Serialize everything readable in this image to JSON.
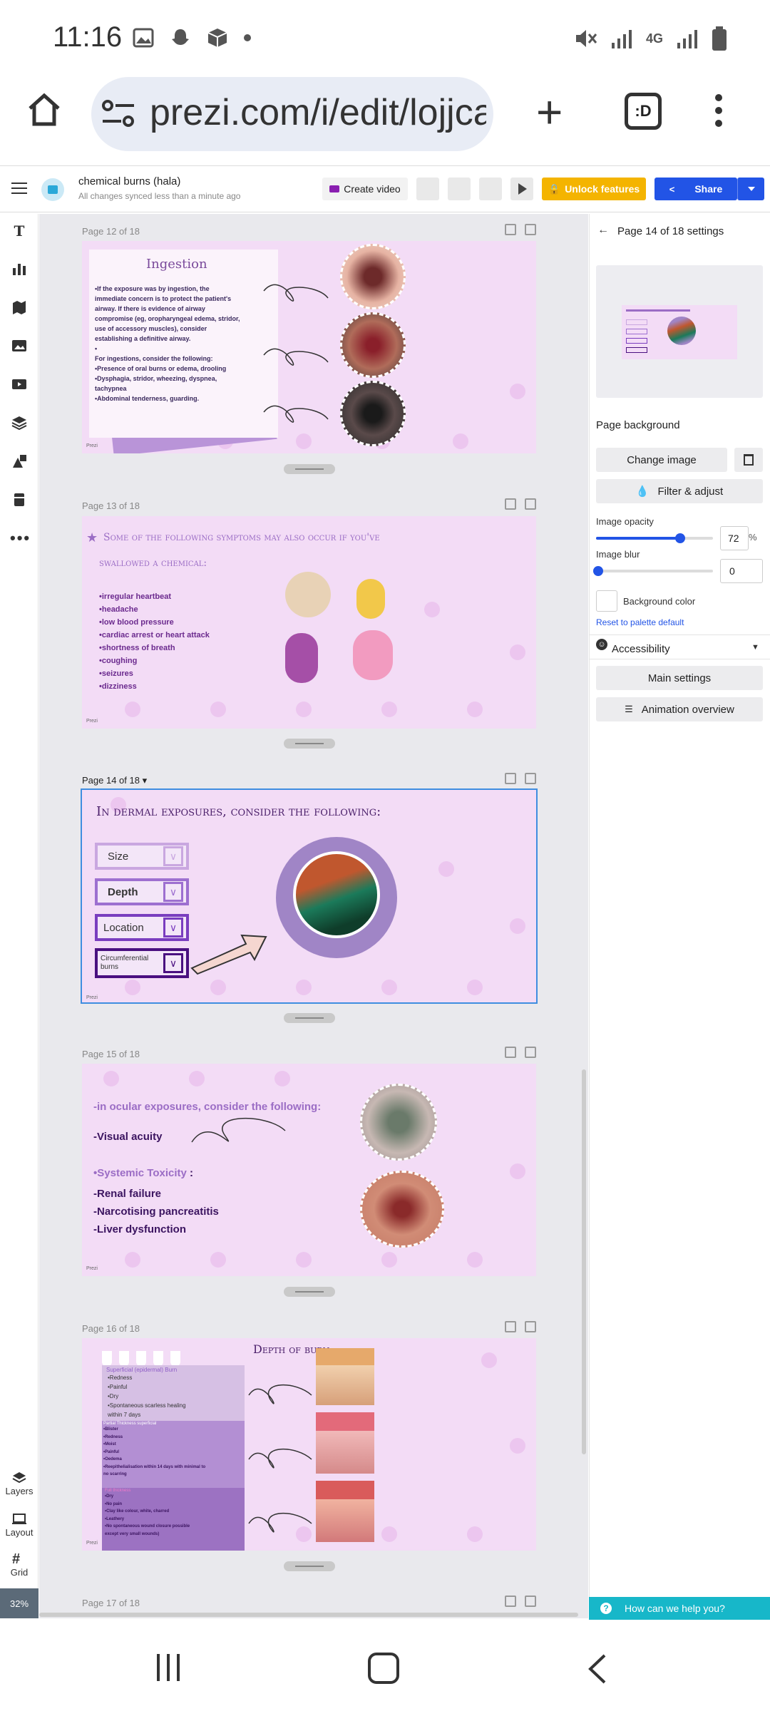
{
  "status": {
    "time": "11:16",
    "network": "4G"
  },
  "browser": {
    "url": "prezi.com/i/edit/lojjca",
    "tabs_label": ":D"
  },
  "app": {
    "doc_title": "chemical burns (hala)",
    "doc_sub": "All changes synced less than a minute ago",
    "create_video": "Create video",
    "unlock": "Unlock features",
    "share": "Share"
  },
  "left_toolbar": {
    "layers": "Layers",
    "layout": "Layout",
    "grid": "Grid",
    "zoom": "32%"
  },
  "pages": [
    {
      "label": "Page 12 of 18"
    },
    {
      "label": "Page 13 of 18"
    },
    {
      "label": "Page 14 of 18"
    },
    {
      "label": "Page 15 of 18"
    },
    {
      "label": "Page 16 of 18"
    },
    {
      "label": "Page 17 of 18"
    }
  ],
  "slide12": {
    "title": "Ingestion",
    "text": [
      "•If the exposure was by ingestion, the",
      "immediate concern is to protect the patient's",
      "airway. If there is evidence of airway",
      "compromise (eg, oropharyngeal edema, stridor,",
      "use of accessory muscles), consider",
      "establishing a definitive airway.",
      "•",
      "For ingestions, consider the following:",
      "•Presence of oral burns or edema, drooling",
      "•Dysphagia, stridor, wheezing, dyspnea,",
      "tachypnea",
      "•Abdominal tenderness, guarding."
    ]
  },
  "slide13": {
    "title1": "Some of the following symptoms may also occur if you've",
    "title2": "swallowed a chemical:",
    "items": [
      "•irregular heartbeat",
      "•headache",
      "•low blood pressure",
      "•cardiac arrest or heart attack",
      "•shortness of breath",
      "•coughing",
      "•seizures",
      "•dizziness"
    ]
  },
  "slide14": {
    "title": "In dermal exposures, consider the following:",
    "boxes": [
      "Size",
      "Depth",
      "Location",
      "Circumferential burns"
    ]
  },
  "slide15": {
    "heading": "-in ocular exposures, consider the following:",
    "visual": "-Visual acuity",
    "systemic_prefix": "•",
    "systemic": "Systemic Toxicity",
    "systemic_suffix": " :",
    "items": [
      "-Renal failure",
      "-Narcotising pancreatitis",
      "-Liver dysfunction"
    ]
  },
  "slide16": {
    "title": "Depth of burn",
    "superficial_head": "Superficial (epidermal) Burn",
    "superficial": [
      "•Redness",
      "•Painful",
      "•Dry",
      "•Spontaneous scarless healing",
      "within 7 days"
    ],
    "partial_head": "Partial Thickness superficial",
    "partial": [
      "•Blister",
      "•Redness",
      "•Moist",
      "•Painful",
      "•Oedema",
      "•Reepithelialisation within 14 days with minimal to",
      "no scarring"
    ],
    "full_head": "Full thickness",
    "full": [
      "•Dry",
      "•No pain",
      "•Clay like colour, white, charred",
      "•Leathery",
      "•No spontaneous wound closure possible",
      "except very small wounds)"
    ]
  },
  "prezi_badge": "Prezi",
  "settings": {
    "title": "Page 14 of 18 settings",
    "page_background": "Page background",
    "change_image": "Change image",
    "filter": "Filter & adjust",
    "opacity_label": "Image opacity",
    "opacity_value": "72",
    "opacity_unit": "%",
    "opacity_fraction": 0.72,
    "blur_label": "Image blur",
    "blur_value": "0",
    "bg_color": "Background color",
    "reset": "Reset to palette default",
    "accessibility": "Accessibility",
    "main_settings": "Main settings",
    "animation": "Animation overview",
    "help": "How can we help you?"
  },
  "colors": {
    "accent": "#2254e6",
    "unlock": "#f4b400",
    "help": "#17b7c9",
    "slide_bg": "#f3dcf6",
    "purple": "#6b2a8e"
  }
}
